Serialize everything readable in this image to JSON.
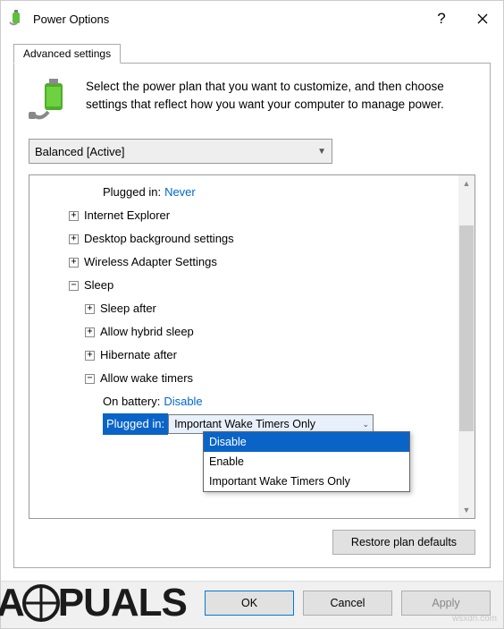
{
  "window": {
    "title": "Power Options",
    "help_tooltip": "?",
    "tab_label": "Advanced settings",
    "intro_text": "Select the power plan that you want to customize, and then choose settings that reflect how you want your computer to manage power.",
    "plan_selected": "Balanced [Active]"
  },
  "tree": {
    "top_plugged_in_label": "Plugged in:",
    "top_plugged_in_value": "Never",
    "items": [
      {
        "label": "Internet Explorer",
        "expand": "plus"
      },
      {
        "label": "Desktop background settings",
        "expand": "plus"
      },
      {
        "label": "Wireless Adapter Settings",
        "expand": "plus"
      },
      {
        "label": "Sleep",
        "expand": "minus"
      }
    ],
    "sleep_children": [
      {
        "label": "Sleep after",
        "expand": "plus"
      },
      {
        "label": "Allow hybrid sleep",
        "expand": "plus"
      },
      {
        "label": "Hibernate after",
        "expand": "plus"
      },
      {
        "label": "Allow wake timers",
        "expand": "minus"
      }
    ],
    "wake_timers": {
      "on_battery_label": "On battery:",
      "on_battery_value": "Disable",
      "plugged_in_label": "Plugged in:",
      "plugged_in_value": "Important Wake Timers Only"
    },
    "dropdown_options": [
      "Disable",
      "Enable",
      "Important Wake Timers Only"
    ]
  },
  "buttons": {
    "restore": "Restore plan defaults",
    "ok": "OK",
    "cancel": "Cancel",
    "apply": "Apply"
  },
  "watermark": "wsxdn.com",
  "logo": {
    "part1": "A",
    "part2": "PUALS"
  }
}
